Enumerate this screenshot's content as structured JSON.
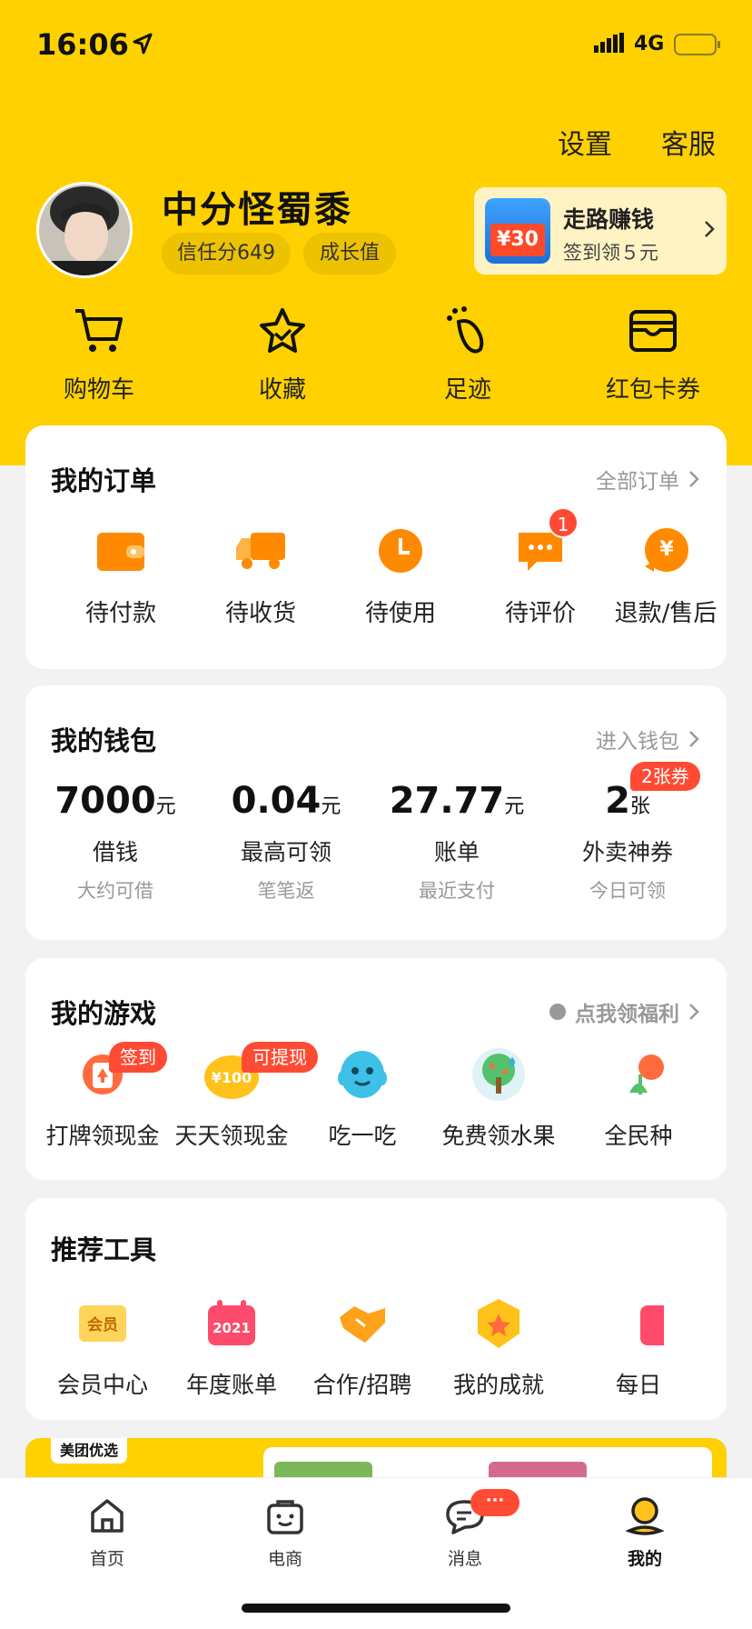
{
  "status": {
    "time": "16:06",
    "network": "4G"
  },
  "header": {
    "settings_label": "设置",
    "service_label": "客服"
  },
  "profile": {
    "name": "中分怪蜀黍",
    "trust_label": "信任分649",
    "growth_label": "成长值"
  },
  "promo": {
    "title": "走路赚钱",
    "subtitle": "签到领５元",
    "coupon_text": "¥30"
  },
  "quick_actions": [
    {
      "label": "购物车",
      "icon": "cart-icon"
    },
    {
      "label": "收藏",
      "icon": "star-icon"
    },
    {
      "label": "足迹",
      "icon": "footprint-icon"
    },
    {
      "label": "红包卡券",
      "icon": "wallet-card-icon"
    }
  ],
  "orders": {
    "title": "我的订单",
    "more": "全部订单",
    "items": [
      {
        "label": "待付款",
        "icon": "wallet-icon"
      },
      {
        "label": "待收货",
        "icon": "truck-icon"
      },
      {
        "label": "待使用",
        "icon": "clock-icon"
      },
      {
        "label": "待评价",
        "icon": "comment-icon",
        "badge": "1"
      },
      {
        "label": "退款/售后",
        "icon": "refund-icon"
      }
    ]
  },
  "wallet": {
    "title": "我的钱包",
    "more": "进入钱包",
    "items": [
      {
        "value": "7000",
        "unit": "元",
        "label": "借钱",
        "sub": "大约可借"
      },
      {
        "value": "0.04",
        "unit": "元",
        "label": "最高可领",
        "sub": "笔笔返"
      },
      {
        "value": "27.77",
        "unit": "元",
        "label": "账单",
        "sub": "最近支付"
      },
      {
        "value": "2",
        "unit": "张",
        "label": "外卖神券",
        "sub": "今日可领",
        "badge": "2张券"
      }
    ]
  },
  "games": {
    "title": "我的游戏",
    "more": "点我领福利",
    "items": [
      {
        "label": "打牌领现金",
        "badge": "签到",
        "icon": "cards-icon"
      },
      {
        "label": "天天领现金",
        "badge": "可提现",
        "icon": "coin-100-icon",
        "coin_text": "¥100"
      },
      {
        "label": "吃一吃",
        "icon": "blue-monster-icon"
      },
      {
        "label": "免费领水果",
        "icon": "fruit-tree-icon"
      },
      {
        "label": "全民种",
        "icon": "flower-icon"
      }
    ]
  },
  "tools": {
    "title": "推荐工具",
    "items": [
      {
        "label": "会员中心",
        "icon": "member-icon",
        "icon_text": "会员"
      },
      {
        "label": "年度账单",
        "icon": "calendar-2021-icon",
        "icon_text": "2021"
      },
      {
        "label": "合作/招聘",
        "icon": "handshake-icon"
      },
      {
        "label": "我的成就",
        "icon": "achievement-icon"
      },
      {
        "label": "每日",
        "icon": "daily-icon"
      }
    ]
  },
  "banner": {
    "tag": "美团优选"
  },
  "tabbar": {
    "items": [
      {
        "label": "首页",
        "icon": "home-icon"
      },
      {
        "label": "电商",
        "icon": "shop-bag-icon"
      },
      {
        "label": "消息",
        "icon": "message-icon",
        "badge": "···"
      },
      {
        "label": "我的",
        "icon": "profile-icon",
        "active": true
      }
    ]
  },
  "colors": {
    "brand": "#FFD100",
    "badge_red": "#FF4B33",
    "orange": "#FF8A00"
  }
}
